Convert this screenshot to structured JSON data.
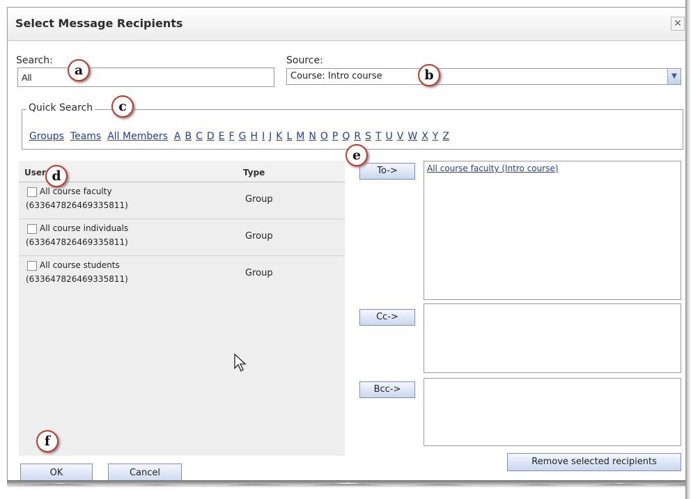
{
  "window": {
    "title": "Select Message Recipients",
    "close_glyph": "✕"
  },
  "search": {
    "label": "Search:",
    "value": "All"
  },
  "source": {
    "label": "Source:",
    "value": "Course: Intro course"
  },
  "quick_search": {
    "legend": "Quick Search",
    "links": [
      "Groups",
      "Teams",
      "All Members",
      "A",
      "B",
      "C",
      "D",
      "E",
      "F",
      "G",
      "H",
      "I",
      "J",
      "K",
      "L",
      "M",
      "N",
      "O",
      "P",
      "Q",
      "R",
      "S",
      "T",
      "U",
      "V",
      "W",
      "X",
      "Y",
      "Z"
    ]
  },
  "users": {
    "col_user": "User",
    "col_type": "Type",
    "rows": [
      {
        "name": "All course faculty",
        "id": "(633647826469335811)",
        "type": "Group"
      },
      {
        "name": "All course individuals",
        "id": "(633647826469335811)",
        "type": "Group"
      },
      {
        "name": "All course students",
        "id": "(633647826469335811)",
        "type": "Group"
      }
    ]
  },
  "recipients": {
    "to_label": "To->",
    "cc_label": "Cc->",
    "bcc_label": "Bcc->",
    "to_items": [
      "All course faculty (Intro course)"
    ],
    "remove_label": "Remove selected recipients"
  },
  "footer": {
    "ok_label": "OK",
    "cancel_label": "Cancel"
  },
  "callouts": {
    "a": "a",
    "b": "b",
    "c": "c",
    "d": "d",
    "e": "e",
    "f": "f"
  },
  "icons": {
    "close": "close-icon",
    "dropdown": "chevron-down-icon",
    "cursor": "mouse-pointer-icon"
  },
  "colors": {
    "link": "#1f3f9a",
    "callout_border": "#c0392b",
    "panel_bg": "#eeeeee"
  }
}
